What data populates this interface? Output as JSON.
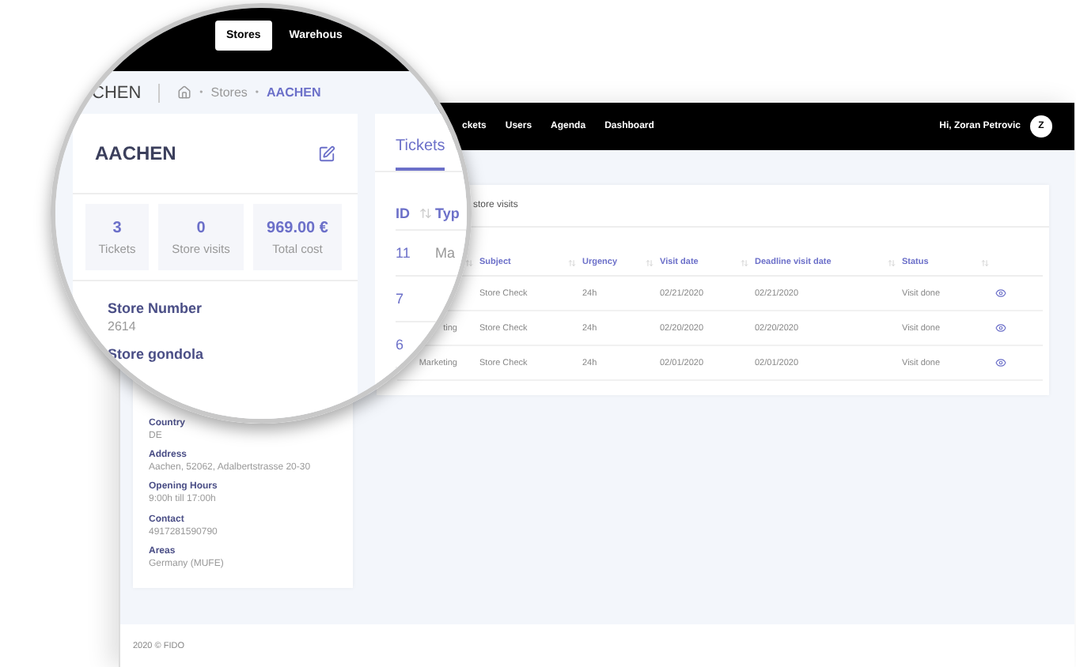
{
  "background": {
    "topbar": {
      "nav": [
        "ckets",
        "Users",
        "Agenda",
        "Dashboard"
      ],
      "greeting": "Hi, Zoran Petrovic",
      "avatar": "Z"
    },
    "store_details": [
      {
        "label": "Country",
        "value": "DE"
      },
      {
        "label": "Address",
        "value": "Aachen, 52062, Adalbertstrasse 20-30"
      },
      {
        "label": "Opening Hours",
        "value": "9:00h till 17:00h"
      },
      {
        "label": "Contact",
        "value": "4917281590790"
      },
      {
        "label": "Areas",
        "value": "Germany (MUFE)"
      }
    ],
    "visits": {
      "title": "store visits",
      "columns": [
        "Subject",
        "Urgency",
        "Visit date",
        "Deadline visit date",
        "Status"
      ],
      "rows": [
        {
          "subject": "Store Check",
          "urgency": "24h",
          "visit_date": "02/21/2020",
          "deadline": "02/21/2020",
          "status": "Visit done"
        },
        {
          "type": "ting",
          "subject": "Store Check",
          "urgency": "24h",
          "visit_date": "02/20/2020",
          "deadline": "02/20/2020",
          "status": "Visit done"
        },
        {
          "type": "Marketing",
          "subject": "Store Check",
          "urgency": "24h",
          "visit_date": "02/01/2020",
          "deadline": "02/01/2020",
          "status": "Visit done"
        }
      ]
    },
    "footer": "2020 © FIDO"
  },
  "magnifier": {
    "nav": [
      {
        "label": "Stores",
        "selected": true
      },
      {
        "label": "Warehous",
        "selected": false
      }
    ],
    "breadcrumb": {
      "title": "CHEN",
      "separator": "•",
      "items": [
        {
          "label": "Stores",
          "current": false
        },
        {
          "label": "AACHEN",
          "current": true
        }
      ]
    },
    "store_card": {
      "name": "AACHEN",
      "stats": [
        {
          "value": "3",
          "label": "Tickets"
        },
        {
          "value": "0",
          "label": "Store visits"
        },
        {
          "value": "969.00 €",
          "label": "Total cost"
        }
      ],
      "fields": [
        {
          "label": "Store Number",
          "value": "2614"
        },
        {
          "label": "Store gondola"
        }
      ]
    },
    "tabs": [
      {
        "label": "Tickets",
        "selected": true
      }
    ],
    "table": {
      "columns": [
        "ID",
        "Typ"
      ],
      "rows": [
        {
          "id": "11",
          "type": "Ma"
        },
        {
          "id": "7"
        },
        {
          "id": "6"
        }
      ]
    }
  }
}
